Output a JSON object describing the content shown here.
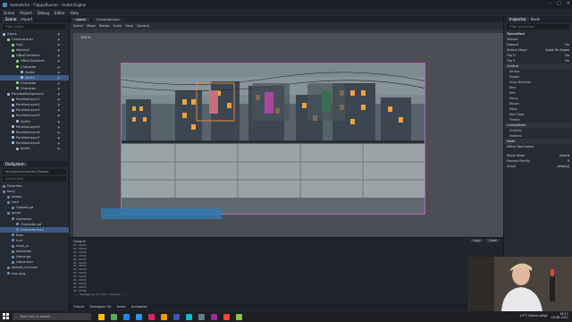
{
  "window": {
    "title": "GameActor - FlappyRunner - Godot Engine"
  },
  "menu": [
    "Scene",
    "Project",
    "Debug",
    "Editor",
    "Help"
  ],
  "workspaces": [
    {
      "label": "2D",
      "active": true
    },
    {
      "label": "3D",
      "active": false
    },
    {
      "label": "Script",
      "active": false
    },
    {
      "label": "AssetLib",
      "active": false
    }
  ],
  "scene_dock": {
    "tabs": [
      "Scene",
      "Import"
    ],
    "filter_placeholder": "Filter nodes",
    "nodes": [
      {
        "label": "Game",
        "indent": 0,
        "color": "#9fbbe0"
      },
      {
        "label": "CameraLayer",
        "indent": 1,
        "color": "#8ed48e"
      },
      {
        "label": "Hud",
        "indent": 2,
        "color": "#8ed48e"
      },
      {
        "label": "Material",
        "indent": 2,
        "color": "#8ed48e"
      },
      {
        "label": "HBoxContainer",
        "indent": 2,
        "color": "#8ed48e"
      },
      {
        "label": "HBoxContainer",
        "indent": 3,
        "color": "#8ed48e"
      },
      {
        "label": "Character",
        "indent": 3,
        "color": "#8ed48e"
      },
      {
        "label": "Sprite",
        "indent": 4,
        "color": "#9fbbe0"
      },
      {
        "label": "Sprite",
        "indent": 4,
        "color": "#9fbbe0",
        "selected": true
      },
      {
        "label": "Character",
        "indent": 3,
        "color": "#8ed48e"
      },
      {
        "label": "Character",
        "indent": 3,
        "color": "#8ed48e"
      },
      {
        "label": "ParallaxBackground",
        "indent": 1,
        "color": "#9fbbe0"
      },
      {
        "label": "ParallaxLayer1",
        "indent": 2,
        "color": "#9fbbe0"
      },
      {
        "label": "ParallaxLayer2",
        "indent": 2,
        "color": "#9fbbe0"
      },
      {
        "label": "ParallaxLayer3",
        "indent": 2,
        "color": "#9fbbe0"
      },
      {
        "label": "ParallaxLayer4",
        "indent": 2,
        "color": "#9fbbe0"
      },
      {
        "label": "Sprite",
        "indent": 3,
        "color": "#9fbbe0"
      },
      {
        "label": "ParallaxLayer5",
        "indent": 2,
        "color": "#9fbbe0"
      },
      {
        "label": "ParallaxLayer6",
        "indent": 2,
        "color": "#9fbbe0"
      },
      {
        "label": "ParallaxLayer7",
        "indent": 2,
        "color": "#9fbbe0"
      },
      {
        "label": "ParallaxLayer8",
        "indent": 2,
        "color": "#9fbbe0"
      },
      {
        "label": "Sprite",
        "indent": 3,
        "color": "#9fbbe0"
      }
    ]
  },
  "fs_dock": {
    "title": "FileSystem",
    "path": "res://game/character/Charact",
    "filter_placeholder": "Search files",
    "items": [
      {
        "label": "Favorites:",
        "indent": 0
      },
      {
        "label": "res://",
        "indent": 0
      },
      {
        "label": "assets",
        "indent": 1
      },
      {
        "label": "core",
        "indent": 1
      },
      {
        "label": "Globals.gd",
        "indent": 2
      },
      {
        "label": "game",
        "indent": 1
      },
      {
        "label": "character",
        "indent": 2
      },
      {
        "label": "Character.gd",
        "indent": 3
      },
      {
        "label": "Character.tscn",
        "indent": 3,
        "selected": true
      },
      {
        "label": "floor",
        "indent": 2
      },
      {
        "label": "hud",
        "indent": 2
      },
      {
        "label": "main_ui",
        "indent": 2
      },
      {
        "label": "obstacles",
        "indent": 2
      },
      {
        "label": "Game.gd",
        "indent": 2
      },
      {
        "label": "Game.tscn",
        "indent": 2
      },
      {
        "label": "default_env.tres",
        "indent": 1
      },
      {
        "label": "icon.png",
        "indent": 1
      }
    ]
  },
  "scene_tabs": [
    {
      "label": "Game",
      "active": true
    },
    {
      "label": "Character.tscn",
      "active": false
    }
  ],
  "viewport": {
    "toolbar": [
      "Select",
      "Move",
      "Rotate",
      "Scale",
      "View",
      "Camera"
    ],
    "zoom": "100 %"
  },
  "output": {
    "title": "Output:",
    "copy_label": "Copy",
    "clear_label": "Clear",
    "lines": [
      "OK 70630",
      "OK 70630",
      "OK 70630",
      "OK 70630",
      "OK 70630",
      "OK 70630",
      "OK 70630",
      "OK 70630",
      "OK 70630",
      "OK 70630",
      "OK 70630",
      "OK 70630",
      "OK 70630",
      "OK 70630",
      "--- Debugging process stopped ---"
    ]
  },
  "bottom_tabs": [
    "Output",
    "Debugger (9)",
    "Audio",
    "Animation"
  ],
  "inspector": {
    "tabs": [
      "Inspector",
      "Node"
    ],
    "filter_placeholder": "Filter properties",
    "node_name": "TextureRect",
    "sections": [
      {
        "type": "row",
        "label": "Texture",
        "value": ""
      },
      {
        "type": "row",
        "label": "Expand",
        "value": "On"
      },
      {
        "type": "row",
        "label": "Stretch Mode",
        "value": "Scale On Expan"
      },
      {
        "type": "row",
        "label": "Flip H",
        "value": "On"
      },
      {
        "type": "row",
        "label": "Flip V",
        "value": "On"
      },
      {
        "type": "head",
        "label": "Control"
      },
      {
        "type": "sub",
        "label": "Anchor"
      },
      {
        "type": "sub",
        "label": "Margin"
      },
      {
        "type": "sub",
        "label": "Grow Direction"
      },
      {
        "type": "sub",
        "label": "Rect"
      },
      {
        "type": "sub",
        "label": "Hint"
      },
      {
        "type": "sub",
        "label": "Focus"
      },
      {
        "type": "sub",
        "label": "Mouse"
      },
      {
        "type": "sub",
        "label": "Input"
      },
      {
        "type": "sub",
        "label": "Size Flags"
      },
      {
        "type": "sub",
        "label": "Theme"
      },
      {
        "type": "head",
        "label": "CanvasItem"
      },
      {
        "type": "sub",
        "label": "Visibility"
      },
      {
        "type": "sub",
        "label": "Material"
      },
      {
        "type": "head",
        "label": "Node"
      },
      {
        "type": "row",
        "label": "Editor Description",
        "value": ""
      },
      {
        "type": "gap",
        "label": ""
      },
      {
        "type": "row",
        "label": "Pause Mode",
        "value": "Inherit"
      },
      {
        "type": "row",
        "label": "Process Priority",
        "value": "0"
      },
      {
        "type": "row",
        "label": "Script",
        "value": "[empty]"
      }
    ]
  },
  "taskbar": {
    "search_placeholder": "Type here to search",
    "weather": "23°C  Delvis soligt",
    "time": "16:11",
    "date": "10.08.2021",
    "icon_colors": [
      "#ffc107",
      "#4caf50",
      "#1e88e5",
      "#2196f3",
      "#e91e63",
      "#ff9800",
      "#3f51b5",
      "#00bcd4",
      "#607d8b",
      "#9c27b0",
      "#f44336",
      "#8bc34a"
    ]
  },
  "colors": {
    "accent": "#4ea1ff",
    "selection": "#3a5a85",
    "viewport_border": "#c65fb9"
  }
}
